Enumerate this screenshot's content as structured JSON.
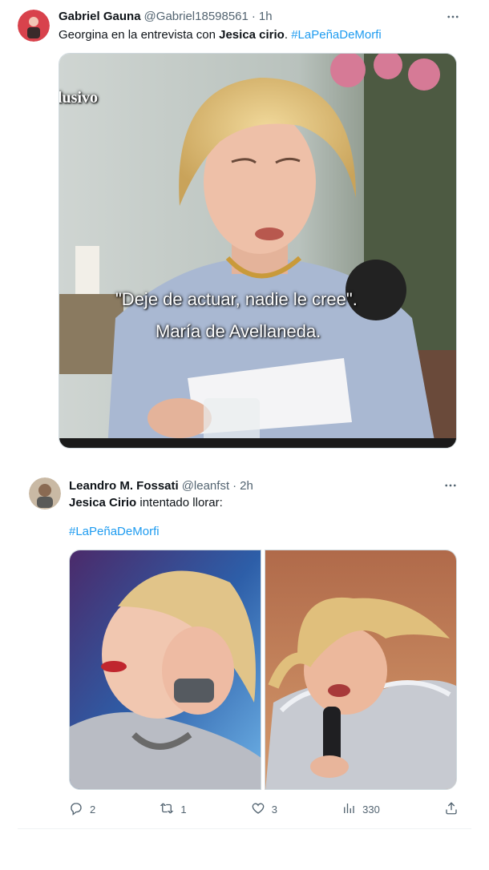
{
  "tweet1": {
    "name": "Gabriel Gauna",
    "handle": "@Gabriel18598561",
    "dot": "·",
    "time": "1h",
    "text_pre": "Georgina en la entrevista con ",
    "text_bold": "Jesica cirio",
    "text_mid": ". ",
    "hashtag": "#LaPeñaDeMorfi",
    "media": {
      "watermark": "lusivo",
      "caption_line1": "\"Deje de actuar, nadie le cree\".",
      "caption_line2": "María de Avellaneda."
    }
  },
  "tweet2": {
    "name": "Leandro M. Fossati",
    "handle": "@leanfst",
    "dot": "·",
    "time": "2h",
    "text_bold": "Jesica Cirio",
    "text_rest": " intentado llorar:",
    "hashtag": "#LaPeñaDeMorfi",
    "actions": {
      "replies": "2",
      "retweets": "1",
      "likes": "3",
      "views": "330"
    }
  },
  "icons": {
    "more": "more-icon",
    "reply": "reply-icon",
    "retweet": "retweet-icon",
    "like": "heart-icon",
    "views": "views-icon",
    "share": "share-icon"
  },
  "colors": {
    "link": "#1d9bf0",
    "secondary": "#536471",
    "text": "#0f1419"
  }
}
